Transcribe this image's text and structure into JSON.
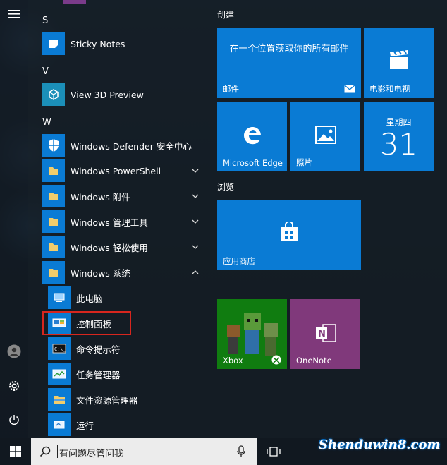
{
  "rail": {
    "menu_icon": "hamburger-icon",
    "user_icon": "user-icon",
    "settings_icon": "gear-icon",
    "power_icon": "power-icon"
  },
  "app_list": {
    "letters": {
      "s": "S",
      "v": "V",
      "w": "W"
    },
    "apps": {
      "sticky": "Sticky Notes",
      "view3d": "View 3D Preview",
      "defender": "Windows Defender 安全中心",
      "powershell": "Windows PowerShell",
      "accessories": "Windows 附件",
      "admin": "Windows 管理工具",
      "ease": "Windows 轻松使用",
      "system": "Windows 系统",
      "thispc": "此电脑",
      "controlpanel": "控制面板",
      "cmd": "命令提示符",
      "taskmgr": "任务管理器",
      "explorer": "文件资源管理器",
      "run": "运行"
    }
  },
  "tiles": {
    "group_create": "创建",
    "group_browse": "浏览",
    "mail_text": "在一个位置获取你的所有邮件",
    "mail_label": "邮件",
    "movies_label": "电影和电视",
    "edge_label": "Microsoft Edge",
    "photos_label": "照片",
    "calendar_day": "星期四",
    "calendar_date": "31",
    "store_label": "应用商店",
    "xbox_label": "Xbox",
    "onenote_label": "OneNote"
  },
  "taskbar": {
    "search_placeholder": "有问题尽管问我",
    "start_icon": "windows-logo-icon",
    "mic_icon": "microphone-icon",
    "taskview_icon": "task-view-icon"
  },
  "watermark": "Shenduwin8.com",
  "colors": {
    "accent": "#0a7bd4",
    "xbox": "#107c10",
    "onenote": "#80397b",
    "highlight": "#d7261e"
  }
}
